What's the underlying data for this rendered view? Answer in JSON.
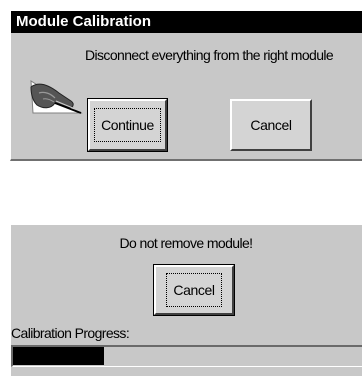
{
  "calibration_dialog": {
    "title": "Module Calibration",
    "message": "Disconnect everything from the right module",
    "icon": "hand-with-pen-icon",
    "continue_label": "Continue",
    "cancel_label": "Cancel"
  },
  "progress_panel": {
    "warning": "Do not remove module!",
    "cancel_label": "Cancel",
    "progress_label": "Calibration Progress:",
    "progress_fraction": 0.26
  },
  "colors": {
    "dialog_background": "#c8c8c8",
    "titlebar_background": "#000000",
    "progress_fill": "#000000"
  }
}
